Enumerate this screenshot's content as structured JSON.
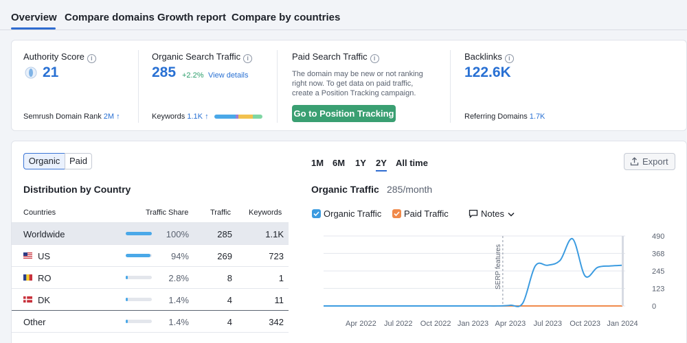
{
  "tabs": [
    {
      "label": "Overview"
    },
    {
      "label": "Compare domains"
    },
    {
      "label": "Growth report"
    },
    {
      "label": "Compare by countries"
    }
  ],
  "summary": {
    "authority": {
      "title": "Authority Score",
      "value": "21",
      "rank_label": "Semrush Domain Rank",
      "rank_value": "2M",
      "rank_arrow": "↑"
    },
    "organic": {
      "title": "Organic Search Traffic",
      "value": "285",
      "change": "+2.2%",
      "details_link": "View details",
      "keywords_label": "Keywords",
      "keywords_value": "1.1K",
      "keywords_arrow": "↑"
    },
    "paid": {
      "title": "Paid Search Traffic",
      "message": "The domain may be new or not ranking right now. To get data on paid traffic, create a Position Tracking campaign.",
      "button": "Go to Position Tracking"
    },
    "backlinks": {
      "title": "Backlinks",
      "value": "122.6K",
      "referring_label": "Referring Domains",
      "referring_value": "1.7K"
    }
  },
  "distribution": {
    "toggle": [
      "Organic",
      "Paid"
    ],
    "title": "Distribution by Country",
    "headers": {
      "country": "Countries",
      "share": "Traffic Share",
      "traffic": "Traffic",
      "keywords": "Keywords"
    },
    "rows": [
      {
        "country": "Worldwide",
        "share": "100%",
        "share_pct": 100,
        "traffic": "285",
        "keywords": "1.1K"
      },
      {
        "country": "US",
        "share": "94%",
        "share_pct": 94,
        "traffic": "269",
        "keywords": "723"
      },
      {
        "country": "RO",
        "share": "2.8%",
        "share_pct": 2.8,
        "traffic": "8",
        "keywords": "1"
      },
      {
        "country": "DK",
        "share": "1.4%",
        "share_pct": 1.4,
        "traffic": "4",
        "keywords": "11"
      },
      {
        "country": "Other",
        "share": "1.4%",
        "share_pct": 1.4,
        "traffic": "4",
        "keywords": "342"
      }
    ]
  },
  "chart_panel": {
    "periods": [
      "1M",
      "6M",
      "1Y",
      "2Y",
      "All time"
    ],
    "selected_period": "2Y",
    "export": "Export",
    "title": "Organic Traffic",
    "subtitle": "285/month",
    "legend": [
      {
        "label": "Organic Traffic",
        "color": "#3b9be0"
      },
      {
        "label": "Paid Traffic",
        "color": "#f0894a"
      }
    ],
    "notes": "Notes",
    "annotation": "SERP features"
  },
  "chart_data": {
    "type": "line",
    "x": [
      "2022-01",
      "2022-02",
      "2022-03",
      "2022-04",
      "2022-05",
      "2022-06",
      "2022-07",
      "2022-08",
      "2022-09",
      "2022-10",
      "2022-11",
      "2022-12",
      "2023-01",
      "2023-02",
      "2023-03",
      "2023-04",
      "2023-05",
      "2023-06",
      "2023-07",
      "2023-08",
      "2023-09",
      "2023-10",
      "2023-11",
      "2023-12",
      "2024-01"
    ],
    "series": [
      {
        "name": "Organic Traffic",
        "color": "#3b9be0",
        "values": [
          0,
          0,
          0,
          0,
          0,
          0,
          0,
          0,
          0,
          0,
          0,
          0,
          0,
          0,
          0,
          5,
          20,
          280,
          285,
          320,
          470,
          210,
          270,
          280,
          285
        ]
      },
      {
        "name": "Paid Traffic",
        "color": "#f0894a",
        "values": [
          0,
          0,
          0,
          0,
          0,
          0,
          0,
          0,
          0,
          0,
          0,
          0,
          0,
          0,
          0,
          0,
          0,
          0,
          0,
          0,
          0,
          0,
          0,
          0,
          0
        ]
      }
    ],
    "x_ticks": [
      "Apr 2022",
      "Jul 2022",
      "Oct 2022",
      "Jan 2023",
      "Apr 2023",
      "Jul 2023",
      "Oct 2023",
      "Jan 2024"
    ],
    "y_ticks": [
      "490",
      "368",
      "245",
      "123",
      "0"
    ],
    "ylim": [
      0,
      490
    ],
    "grid": true,
    "annotation_at": "2023-04"
  }
}
